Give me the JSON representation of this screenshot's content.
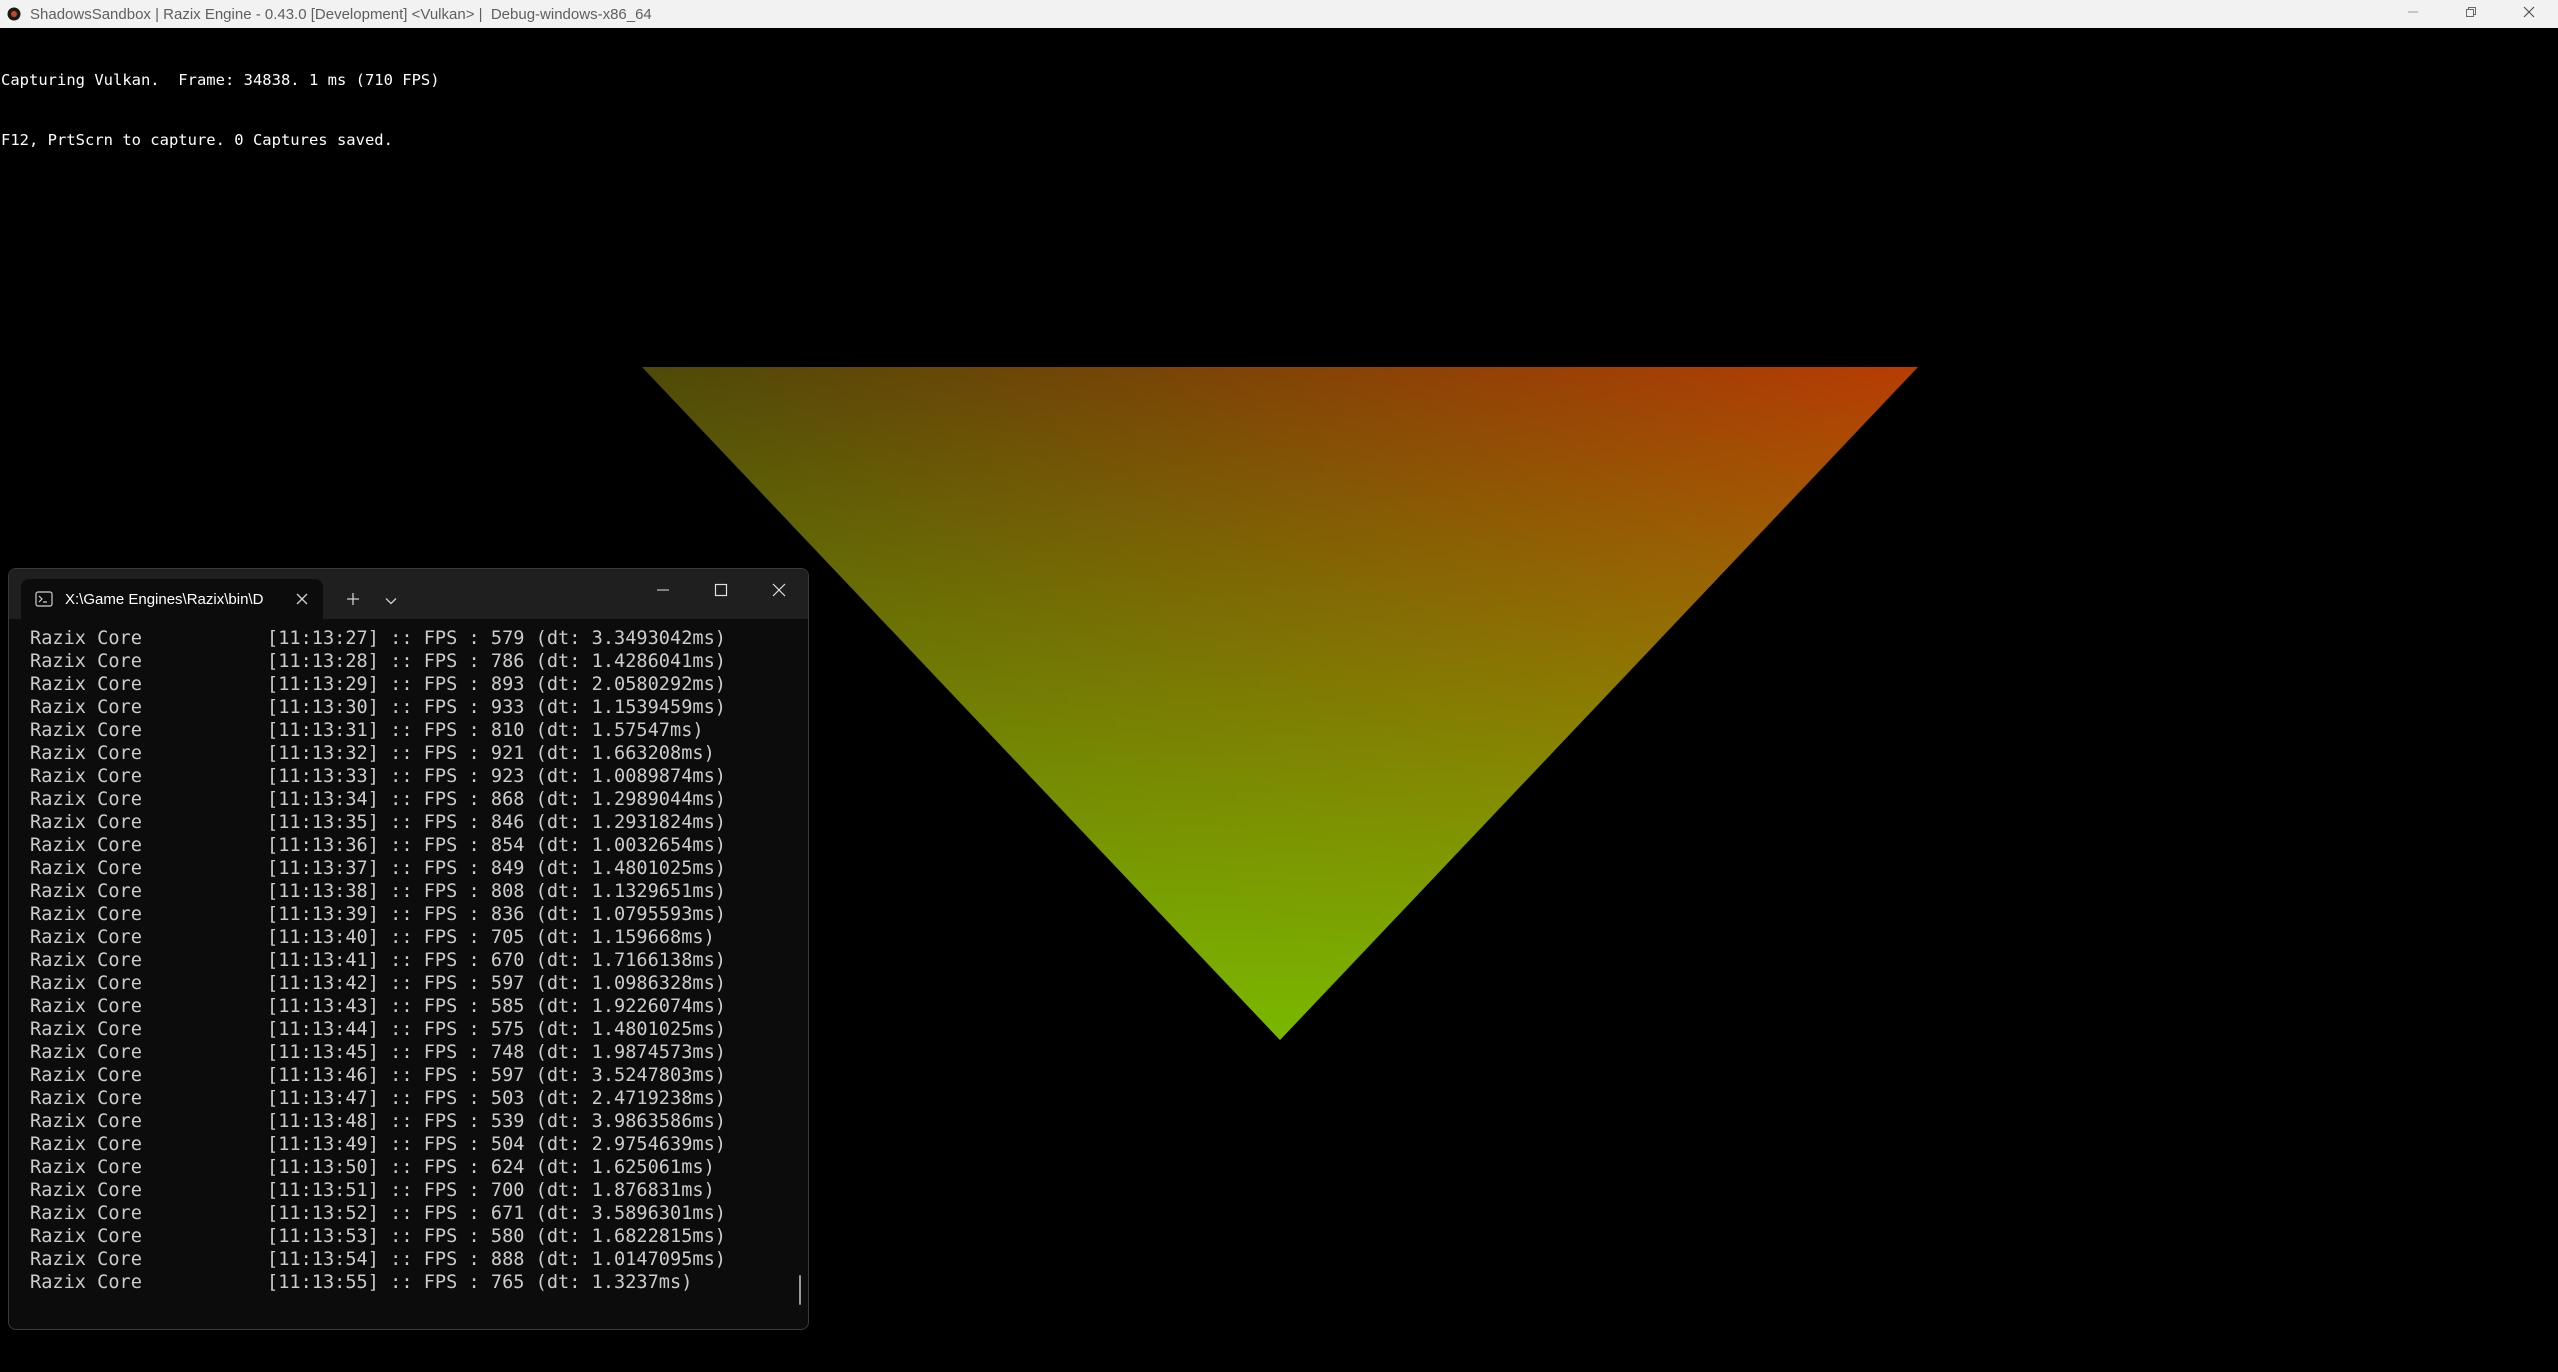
{
  "window": {
    "title": "ShadowsSandbox | Razix Engine - 0.43.0 [Development] <Vulkan> |  Debug-windows-x86_64",
    "icon": "app-logo-icon",
    "controls": [
      "minimize-icon",
      "restore-icon",
      "close-icon"
    ]
  },
  "overlay": {
    "line1": "Capturing Vulkan.  Frame: 34838. 1 ms (710 FPS)",
    "line2": "F12, PrtScrn to capture. 0 Captures saved."
  },
  "scene": {
    "colors": {
      "top_left": "#4e4a08",
      "top_right": "#b83c04",
      "bottom": "#79b800"
    }
  },
  "terminal": {
    "tab_title": "X:\\Game Engines\\Razix\\bin\\D",
    "tab_icon": "terminal-icon",
    "new_tab_icon": "plus-icon",
    "dropdown_icon": "chevron-down-icon",
    "background": "#0c0c0c",
    "text_color": "#cccccc",
    "log": [
      {
        "source": "Razix Core",
        "message": "[11:13:27] :: FPS : 579 (dt: 3.3493042ms)"
      },
      {
        "source": "Razix Core",
        "message": "[11:13:28] :: FPS : 786 (dt: 1.4286041ms)"
      },
      {
        "source": "Razix Core",
        "message": "[11:13:29] :: FPS : 893 (dt: 2.0580292ms)"
      },
      {
        "source": "Razix Core",
        "message": "[11:13:30] :: FPS : 933 (dt: 1.1539459ms)"
      },
      {
        "source": "Razix Core",
        "message": "[11:13:31] :: FPS : 810 (dt: 1.57547ms)"
      },
      {
        "source": "Razix Core",
        "message": "[11:13:32] :: FPS : 921 (dt: 1.663208ms)"
      },
      {
        "source": "Razix Core",
        "message": "[11:13:33] :: FPS : 923 (dt: 1.0089874ms)"
      },
      {
        "source": "Razix Core",
        "message": "[11:13:34] :: FPS : 868 (dt: 1.2989044ms)"
      },
      {
        "source": "Razix Core",
        "message": "[11:13:35] :: FPS : 846 (dt: 1.2931824ms)"
      },
      {
        "source": "Razix Core",
        "message": "[11:13:36] :: FPS : 854 (dt: 1.0032654ms)"
      },
      {
        "source": "Razix Core",
        "message": "[11:13:37] :: FPS : 849 (dt: 1.4801025ms)"
      },
      {
        "source": "Razix Core",
        "message": "[11:13:38] :: FPS : 808 (dt: 1.1329651ms)"
      },
      {
        "source": "Razix Core",
        "message": "[11:13:39] :: FPS : 836 (dt: 1.0795593ms)"
      },
      {
        "source": "Razix Core",
        "message": "[11:13:40] :: FPS : 705 (dt: 1.159668ms)"
      },
      {
        "source": "Razix Core",
        "message": "[11:13:41] :: FPS : 670 (dt: 1.7166138ms)"
      },
      {
        "source": "Razix Core",
        "message": "[11:13:42] :: FPS : 597 (dt: 1.0986328ms)"
      },
      {
        "source": "Razix Core",
        "message": "[11:13:43] :: FPS : 585 (dt: 1.9226074ms)"
      },
      {
        "source": "Razix Core",
        "message": "[11:13:44] :: FPS : 575 (dt: 1.4801025ms)"
      },
      {
        "source": "Razix Core",
        "message": "[11:13:45] :: FPS : 748 (dt: 1.9874573ms)"
      },
      {
        "source": "Razix Core",
        "message": "[11:13:46] :: FPS : 597 (dt: 3.5247803ms)"
      },
      {
        "source": "Razix Core",
        "message": "[11:13:47] :: FPS : 503 (dt: 2.4719238ms)"
      },
      {
        "source": "Razix Core",
        "message": "[11:13:48] :: FPS : 539 (dt: 3.9863586ms)"
      },
      {
        "source": "Razix Core",
        "message": "[11:13:49] :: FPS : 504 (dt: 2.9754639ms)"
      },
      {
        "source": "Razix Core",
        "message": "[11:13:50] :: FPS : 624 (dt: 1.625061ms)"
      },
      {
        "source": "Razix Core",
        "message": "[11:13:51] :: FPS : 700 (dt: 1.876831ms)"
      },
      {
        "source": "Razix Core",
        "message": "[11:13:52] :: FPS : 671 (dt: 3.5896301ms)"
      },
      {
        "source": "Razix Core",
        "message": "[11:13:53] :: FPS : 580 (dt: 1.6822815ms)"
      },
      {
        "source": "Razix Core",
        "message": "[11:13:54] :: FPS : 888 (dt: 1.0147095ms)"
      },
      {
        "source": "Razix Core",
        "message": "[11:13:55] :: FPS : 765 (dt: 1.3237ms)"
      }
    ]
  }
}
